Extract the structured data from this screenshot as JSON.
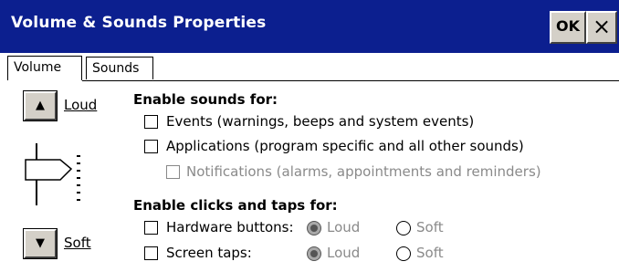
{
  "window": {
    "title": "Volume & Sounds Properties",
    "ok_label": "OK",
    "close_glyph": "×"
  },
  "tabs": [
    {
      "label": "Volume",
      "active": true
    },
    {
      "label": "Sounds",
      "active": false
    }
  ],
  "volume": {
    "loud_label": "Loud",
    "soft_label": "Soft",
    "up_glyph": "▲",
    "down_glyph": "▼",
    "level": 0.5
  },
  "enable_sounds": {
    "title": "Enable sounds for:",
    "events": {
      "label": "Events (warnings, beeps and system events)",
      "checked": false
    },
    "applications": {
      "label": "Applications (program specific and all other sounds)",
      "checked": false
    },
    "notifications": {
      "label": "Notifications (alarms, appointments and reminders)",
      "checked": false,
      "disabled": true
    }
  },
  "enable_clicks": {
    "title": "Enable clicks and taps for:",
    "hardware": {
      "label": "Hardware buttons:",
      "checked": false,
      "loud": "Loud",
      "soft": "Soft",
      "selected": "loud"
    },
    "screen": {
      "label": "Screen taps:",
      "checked": false,
      "loud": "Loud",
      "soft": "Soft",
      "selected": "loud"
    }
  },
  "colors": {
    "titlebar": "#0c1f8f",
    "button_face": "#d4d0c8",
    "disabled_text": "#8a8a8a"
  }
}
